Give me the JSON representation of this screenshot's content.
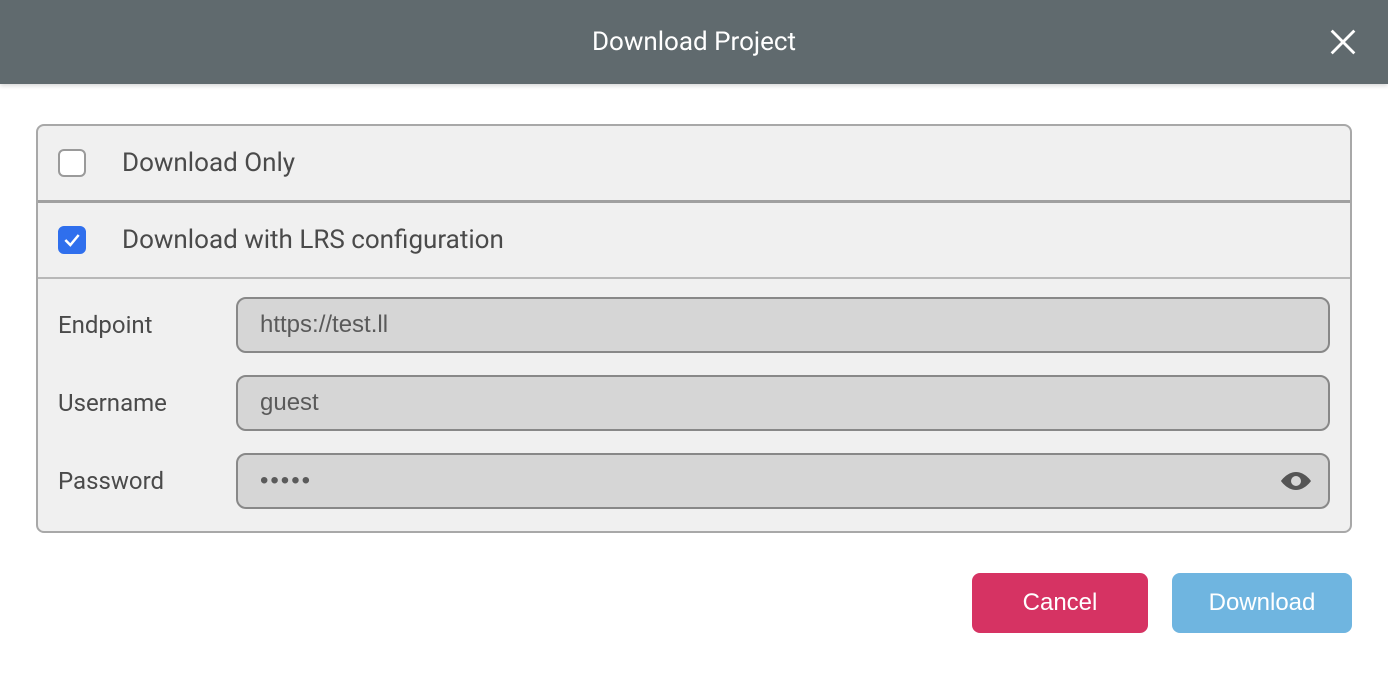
{
  "header": {
    "title": "Download Project"
  },
  "options": {
    "download_only": {
      "label": "Download Only",
      "checked": false
    },
    "download_lrs": {
      "label": "Download with LRS configuration",
      "checked": true
    }
  },
  "form": {
    "endpoint": {
      "label": "Endpoint",
      "value": "https://test.ll"
    },
    "username": {
      "label": "Username",
      "value": "guest"
    },
    "password": {
      "label": "Password",
      "value": "•••••"
    }
  },
  "actions": {
    "cancel": "Cancel",
    "download": "Download"
  }
}
